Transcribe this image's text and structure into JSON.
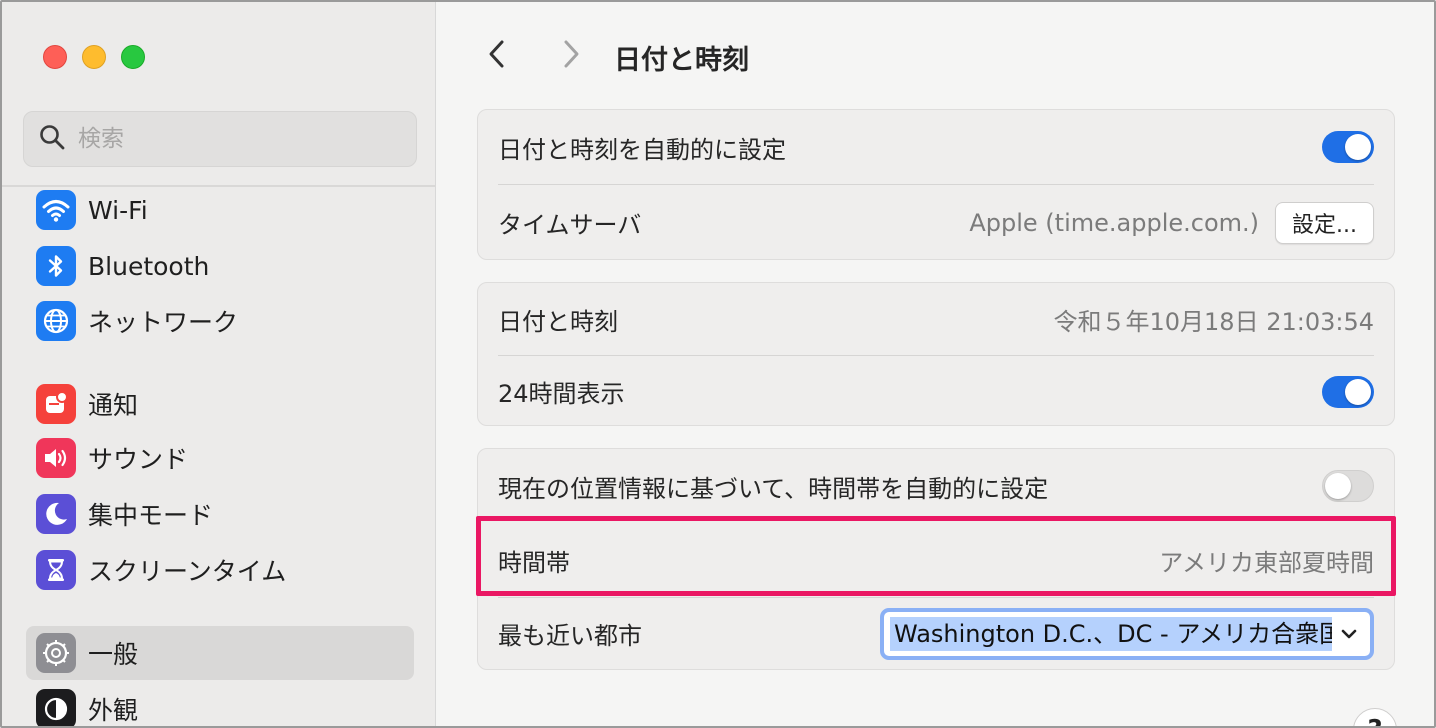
{
  "window": {
    "title": "日付と時刻"
  },
  "search": {
    "placeholder": "検索"
  },
  "sidebar": {
    "items": [
      {
        "label": "Wi-Fi",
        "icon": "wifi-icon",
        "color": "#1e7cf2"
      },
      {
        "label": "Bluetooth",
        "icon": "bluetooth-icon",
        "color": "#1e7cf2"
      },
      {
        "label": "ネットワーク",
        "icon": "globe-icon",
        "color": "#1e7cf2"
      },
      {
        "label": "通知",
        "icon": "bell-icon",
        "color": "#f5413b"
      },
      {
        "label": "サウンド",
        "icon": "speaker-icon",
        "color": "#f0365a"
      },
      {
        "label": "集中モード",
        "icon": "moon-icon",
        "color": "#5b4fd6"
      },
      {
        "label": "スクリーンタイム",
        "icon": "hourglass-icon",
        "color": "#5b4fd6"
      },
      {
        "label": "一般",
        "icon": "gear-icon",
        "color": "#8e8e93",
        "selected": true
      },
      {
        "label": "外観",
        "icon": "appearance-icon",
        "color": "#1c1c1e"
      }
    ]
  },
  "groups": {
    "auto": {
      "auto_set_label": "日付と時刻を自動的に設定",
      "auto_set_on": true,
      "time_server_label": "タイムサーバ",
      "time_server_value": "Apple (time.apple.com.)",
      "time_server_button": "設定..."
    },
    "datetime": {
      "datetime_label": "日付と時刻",
      "datetime_value": "令和５年10月18日 21:03:54",
      "hour24_label": "24時間表示",
      "hour24_on": true
    },
    "timezone": {
      "auto_tz_label": "現在の位置情報に基づいて、時間帯を自動的に設定",
      "auto_tz_on": false,
      "timezone_label": "時間帯",
      "timezone_value": "アメリカ東部夏時間",
      "nearest_city_label": "最も近い都市",
      "nearest_city_value": "Washington D.C.、DC - アメリカ合衆国"
    }
  },
  "help": {
    "label": "?"
  },
  "colors": {
    "accent": "#1f6fe6",
    "highlight": "#ea1763"
  }
}
